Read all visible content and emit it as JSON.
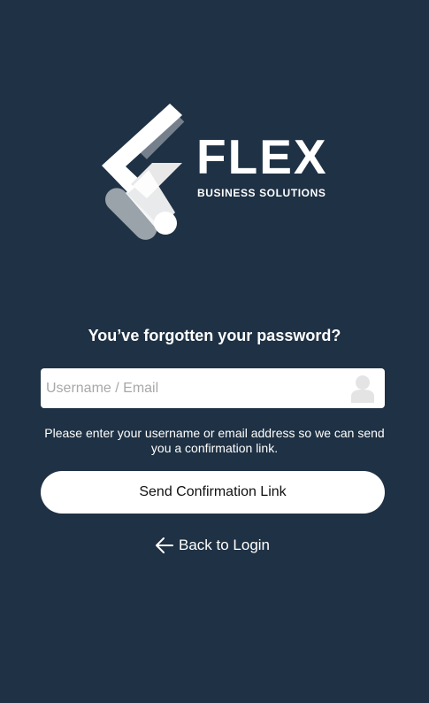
{
  "brand": {
    "name": "FLEX",
    "tagline": "BUSINESS SOLUTIONS"
  },
  "page": {
    "heading": "You’ve forgotten your password?"
  },
  "form": {
    "username_placeholder": "Username / Email",
    "username_value": "",
    "helper_text": "Please enter your username or email address so we can send you a confirmation link.",
    "submit_label": "Send Confirmation Link"
  },
  "navigation": {
    "back_label": "Back to Login"
  },
  "icons": {
    "input": "user-icon",
    "back": "arrow-left-icon"
  },
  "colors": {
    "background": "#1f3144",
    "button": "#ffffff",
    "text": "#ffffff"
  }
}
